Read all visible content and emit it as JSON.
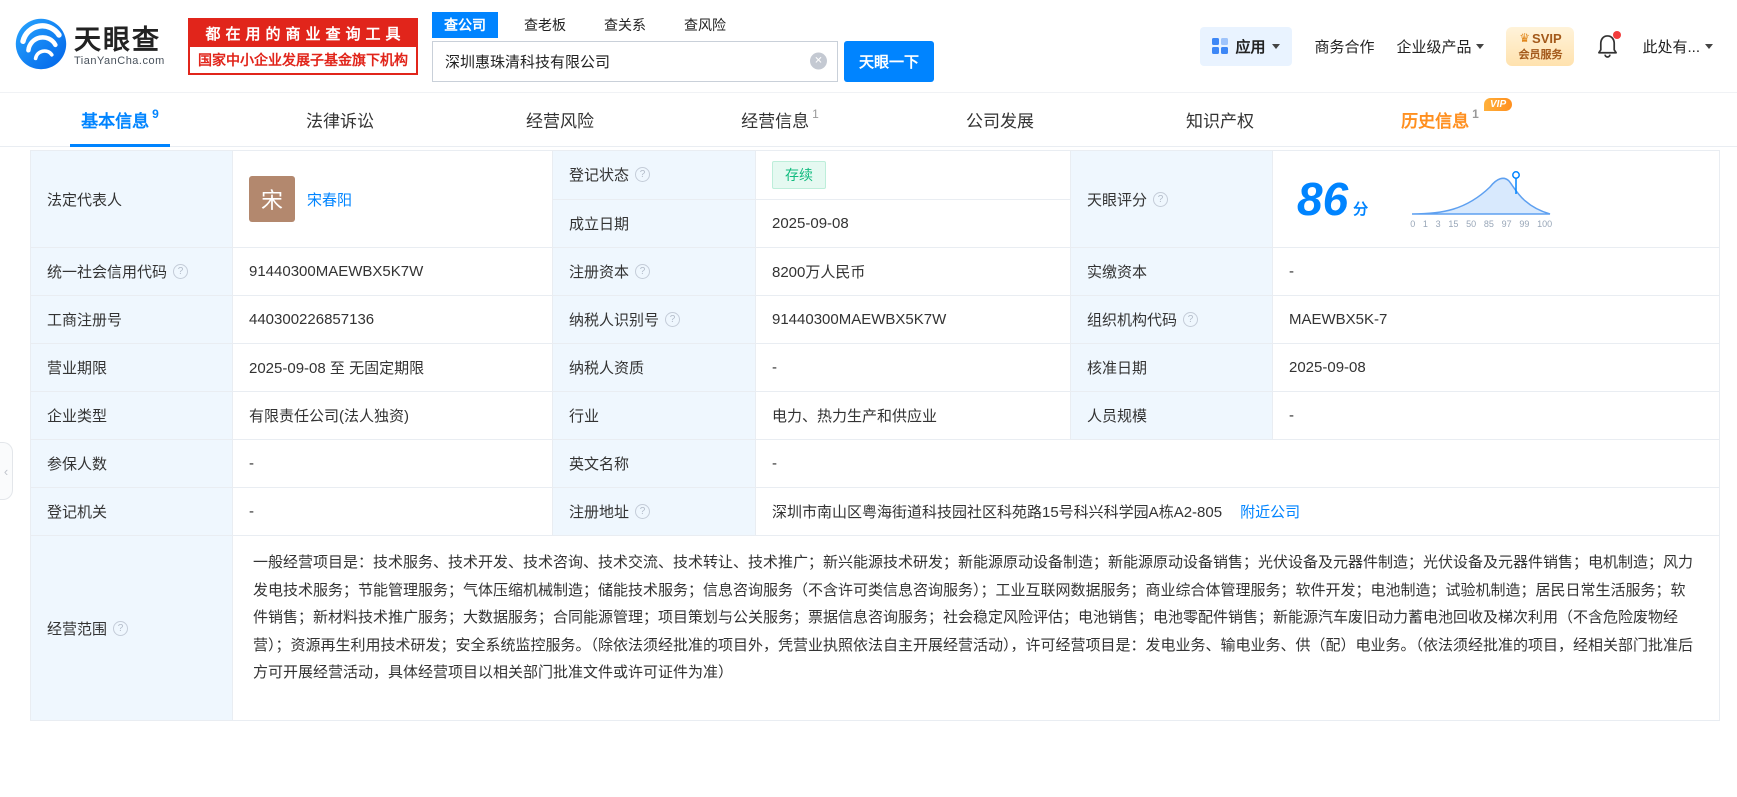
{
  "icons": {
    "help": "?",
    "clear": "✕",
    "crown": "♛",
    "chevron": "‹"
  },
  "header": {
    "logo": {
      "cn": "天眼查",
      "en": "TianYanCha.com"
    },
    "promo": {
      "line1": "都在用的商业查询工具",
      "line2": "国家中小企业发展子基金旗下机构"
    },
    "search": {
      "tabs": [
        {
          "label": "查公司"
        },
        {
          "label": "查老板"
        },
        {
          "label": "查关系"
        },
        {
          "label": "查风险"
        }
      ],
      "value": "深圳惠珠清科技有限公司",
      "button": "天眼一下"
    },
    "right": {
      "apps": "应用",
      "link1": "商务合作",
      "link2": "企业级产品",
      "svip_line1": "SVIP",
      "svip_line2": "会员服务",
      "user": "此处有..."
    }
  },
  "nav": {
    "tabs": [
      {
        "label": "基本信息",
        "count": "9"
      },
      {
        "label": "法律诉讼"
      },
      {
        "label": "经营风险"
      },
      {
        "label": "经营信息",
        "count": "1"
      },
      {
        "label": "公司发展"
      },
      {
        "label": "知识产权"
      },
      {
        "label": "历史信息",
        "count": "1",
        "vip": "VIP"
      }
    ]
  },
  "table": {
    "legal_rep": {
      "label": "法定代表人",
      "avatar": "宋",
      "name": "宋春阳"
    },
    "reg_status": {
      "label": "登记状态",
      "value": "存续"
    },
    "est_date": {
      "label": "成立日期",
      "value": "2025-09-08"
    },
    "score": {
      "label": "天眼评分",
      "value": "86",
      "unit": "分",
      "axis": [
        "0",
        "1",
        "3",
        "15",
        "50",
        "85",
        "97",
        "99",
        "100"
      ]
    },
    "credit_code": {
      "label": "统一社会信用代码",
      "value": "91440300MAEWBX5K7W"
    },
    "reg_capital": {
      "label": "注册资本",
      "value": "8200万人民币"
    },
    "paid_capital": {
      "label": "实缴资本",
      "value": "-"
    },
    "reg_number": {
      "label": "工商注册号",
      "value": "440300226857136"
    },
    "taxpayer_id": {
      "label": "纳税人识别号",
      "value": "91440300MAEWBX5K7W"
    },
    "org_code": {
      "label": "组织机构代码",
      "value": "MAEWBX5K-7"
    },
    "business_term": {
      "label": "营业期限",
      "value": "2025-09-08 至 无固定期限"
    },
    "taxpayer_quality": {
      "label": "纳税人资质",
      "value": "-"
    },
    "approval_date": {
      "label": "核准日期",
      "value": "2025-09-08"
    },
    "company_type": {
      "label": "企业类型",
      "value": "有限责任公司(法人独资)"
    },
    "industry": {
      "label": "行业",
      "value": "电力、热力生产和供应业"
    },
    "staff_size": {
      "label": "人员规模",
      "value": "-"
    },
    "insured_count": {
      "label": "参保人数",
      "value": "-"
    },
    "english_name": {
      "label": "英文名称",
      "value": "-"
    },
    "reg_authority": {
      "label": "登记机关",
      "value": "-"
    },
    "reg_address": {
      "label": "注册地址",
      "value": "深圳市南山区粤海街道科技园社区科苑路15号科兴科学园A栋A2-805",
      "link": "附近公司"
    },
    "business_scope": {
      "label": "经营范围",
      "value": "一般经营项目是：技术服务、技术开发、技术咨询、技术交流、技术转让、技术推广；新兴能源技术研发；新能源原动设备制造；新能源原动设备销售；光伏设备及元器件制造；光伏设备及元器件销售；电机制造；风力发电技术服务；节能管理服务；气体压缩机械制造；储能技术服务；信息咨询服务（不含许可类信息咨询服务）；工业互联网数据服务；商业综合体管理服务；软件开发；电池制造；试验机制造；居民日常生活服务；软件销售；新材料技术推广服务；大数据服务；合同能源管理；项目策划与公关服务；票据信息咨询服务；社会稳定风险评估；电池销售；电池零配件销售；新能源汽车废旧动力蓄电池回收及梯次利用（不含危险废物经营）；资源再生利用技术研发；安全系统监控服务。（除依法须经批准的项目外，凭营业执照依法自主开展经营活动），许可经营项目是：发电业务、输电业务、供（配）电业务。（依法须经批准的项目，经相关部门批准后方可开展经营活动，具体经营项目以相关部门批准文件或许可证件为准）"
    }
  }
}
